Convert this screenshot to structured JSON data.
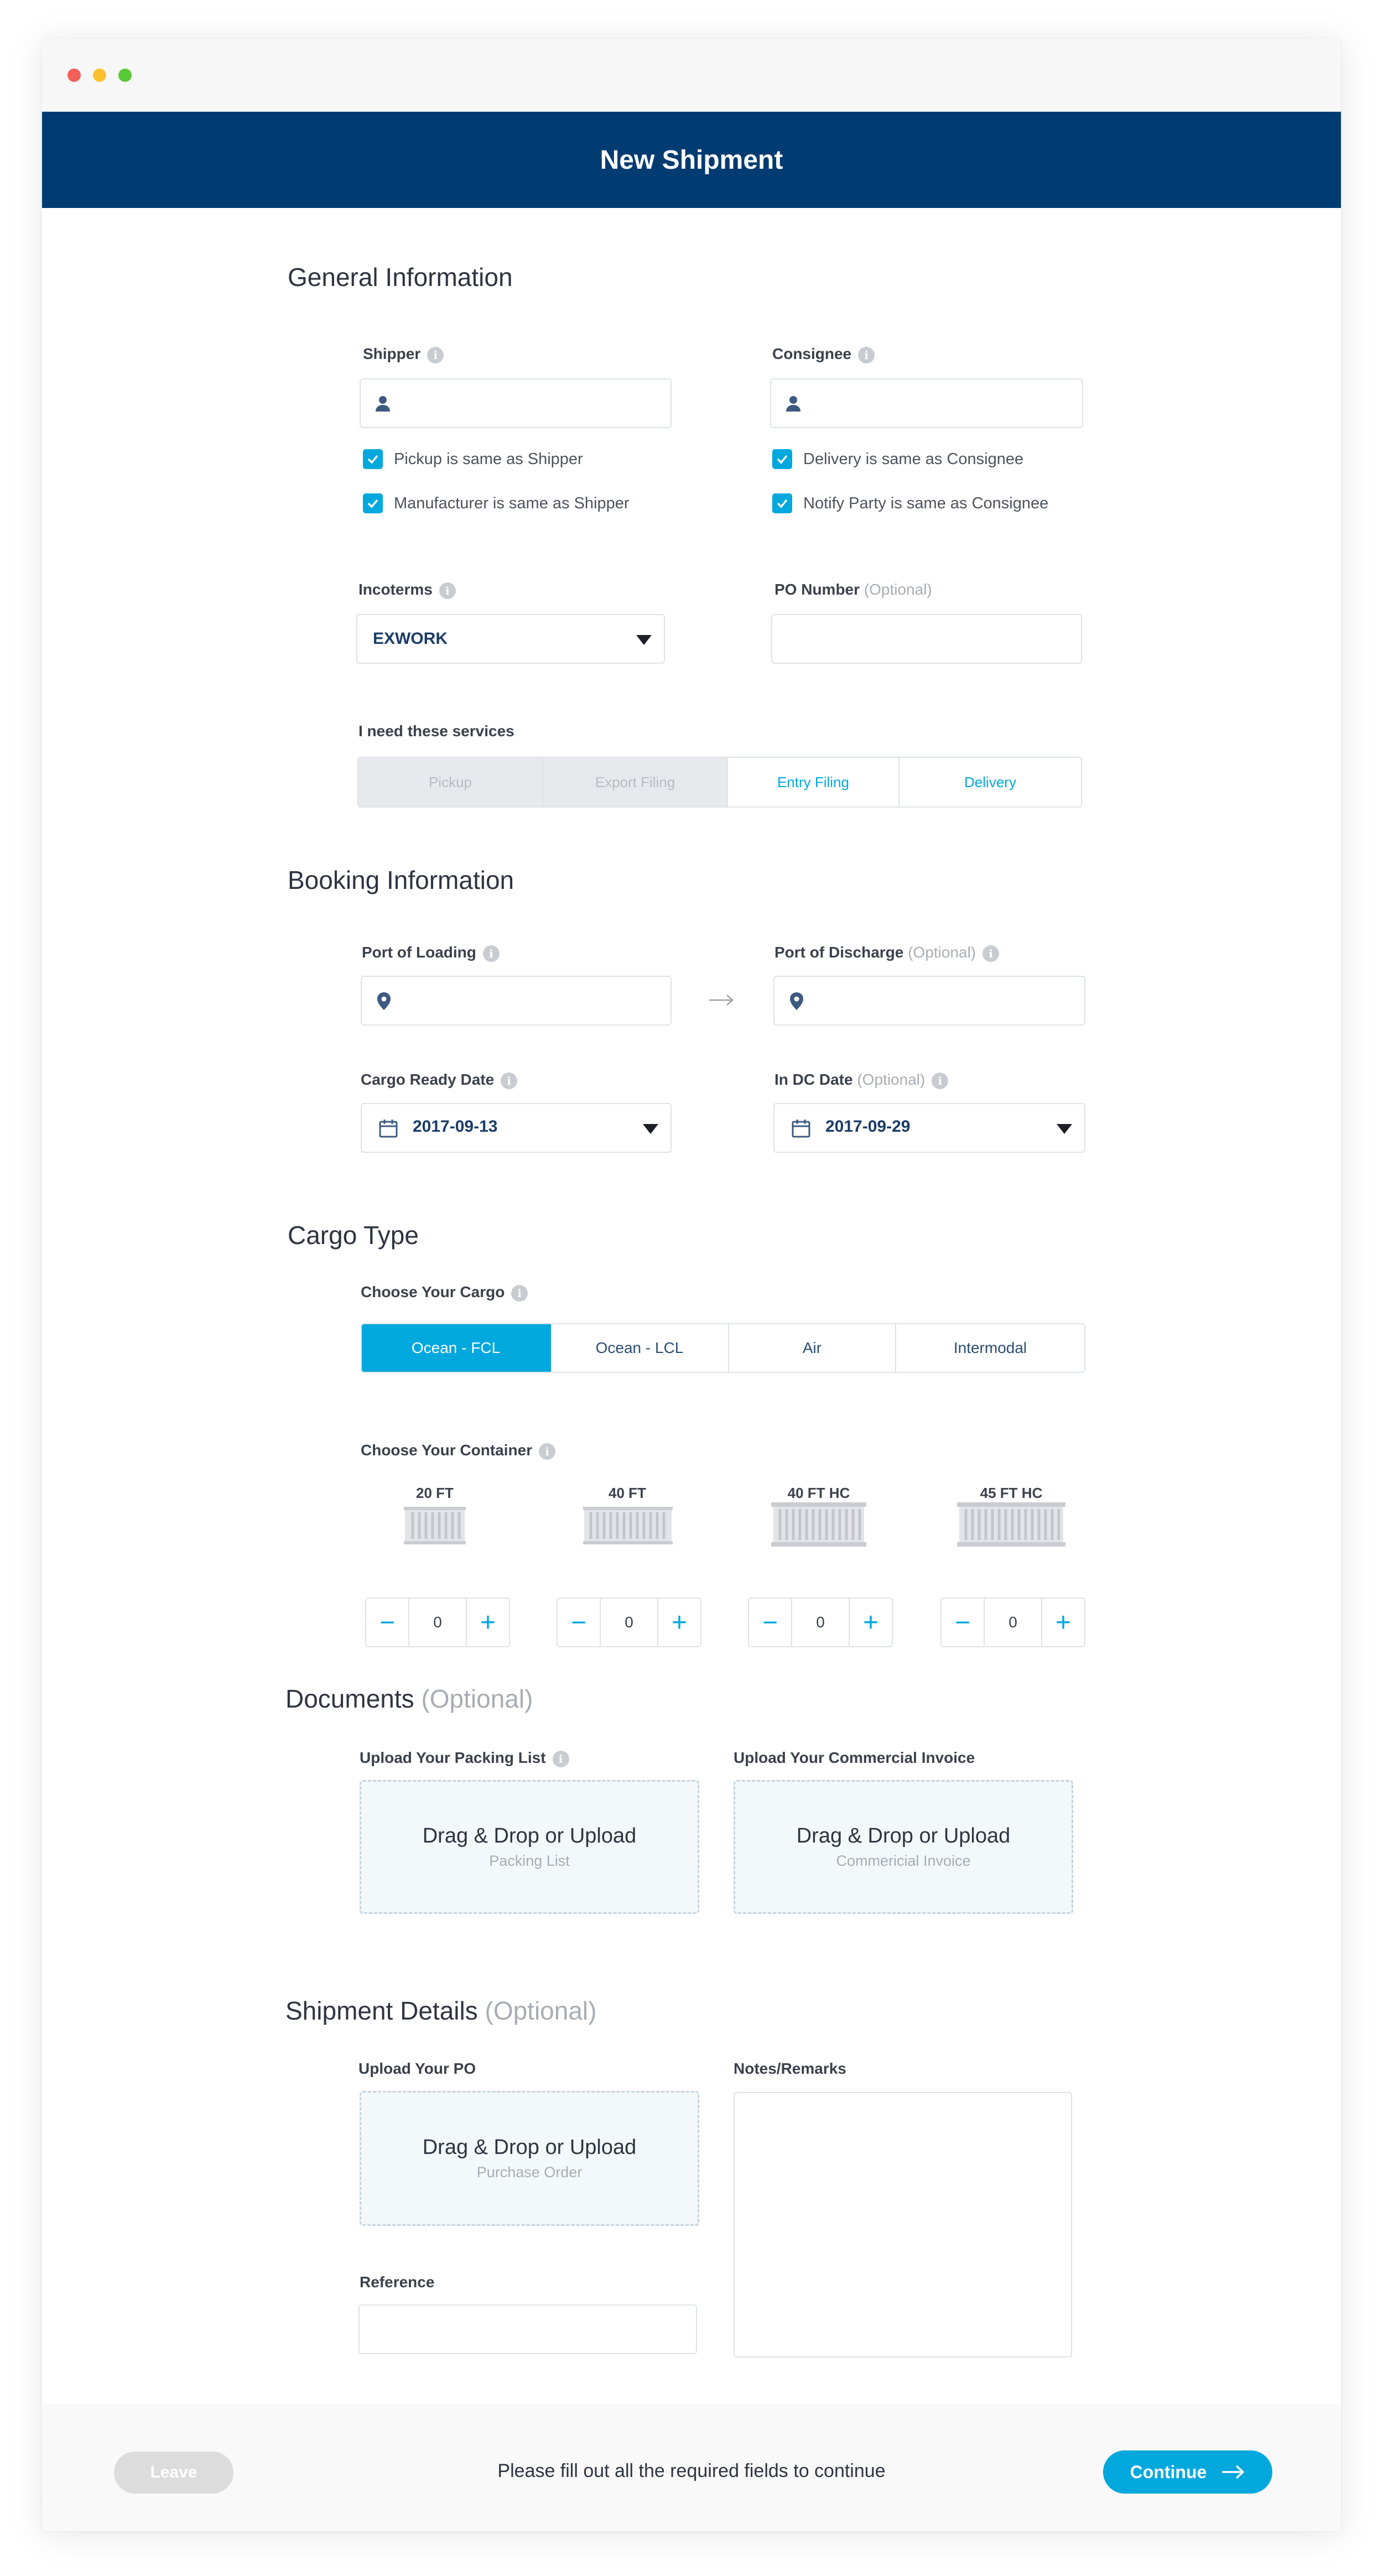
{
  "header": {
    "title": "New Shipment"
  },
  "general": {
    "title": "General Information",
    "shipper_label": "Shipper",
    "consignee_label": "Consignee",
    "checks_left": [
      "Pickup is same as Shipper",
      "Manufacturer is same as Shipper"
    ],
    "checks_right": [
      "Delivery is same as Consignee",
      "Notify Party is same as Consignee"
    ],
    "incoterms_label": "Incoterms",
    "incoterms_value": "EXWORK",
    "po_label": "PO Number",
    "po_optional": "(Optional)",
    "services_label": "I need these services",
    "services": [
      "Pickup",
      "Export Filing",
      "Entry Filing",
      "Delivery"
    ]
  },
  "booking": {
    "title": "Booking Information",
    "loading_label": "Port of Loading",
    "discharge_label": "Port of Discharge",
    "discharge_optional": "(Optional)",
    "ready_label": "Cargo Ready Date",
    "ready_value": "2017-09-13",
    "indc_label": "In DC Date",
    "indc_optional": "(Optional)",
    "indc_value": "2017-09-29"
  },
  "cargo": {
    "title": "Cargo Type",
    "choose_cargo_label": "Choose Your Cargo",
    "cargo_options": [
      "Ocean - FCL",
      "Ocean - LCL",
      "Air",
      "Intermodal"
    ],
    "choose_container_label": "Choose Your Container",
    "containers": [
      {
        "label": "20 FT",
        "qty": "0"
      },
      {
        "label": "40 FT",
        "qty": "0"
      },
      {
        "label": "40 FT HC",
        "qty": "0"
      },
      {
        "label": "45 FT HC",
        "qty": "0"
      }
    ]
  },
  "documents": {
    "title": "Documents",
    "optional": "(Optional)",
    "packing_label": "Upload Your Packing List",
    "invoice_label": "Upload Your Commercial Invoice",
    "drop_text": "Drag & Drop or Upload",
    "packing_sub": "Packing List",
    "invoice_sub": "Commericial Invoice"
  },
  "details": {
    "title": "Shipment Details",
    "optional": "(Optional)",
    "po_upload_label": "Upload Your PO",
    "drop_text": "Drag & Drop or Upload",
    "po_sub": "Purchase Order",
    "notes_label": "Notes/Remarks",
    "reference_label": "Reference"
  },
  "footer": {
    "leave": "Leave",
    "message": "Please fill out all the required fields to continue",
    "continue": "Continue"
  },
  "colors": {
    "brand": "#003c71",
    "accent": "#00a8de"
  }
}
